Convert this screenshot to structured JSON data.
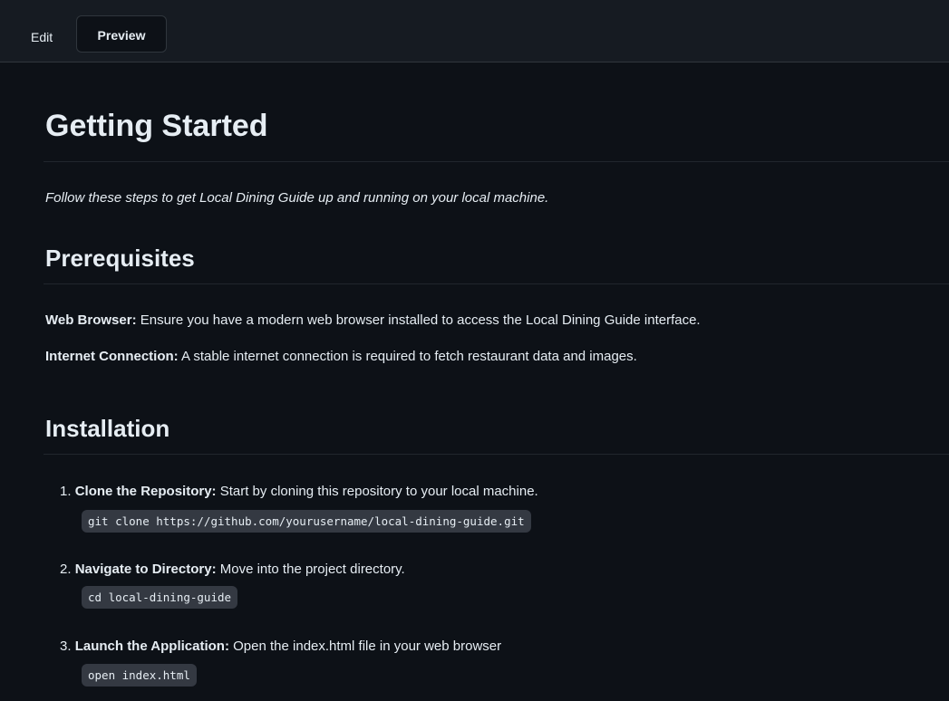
{
  "tabs": {
    "edit_label": "Edit",
    "preview_label": "Preview"
  },
  "doc": {
    "title": "Getting Started",
    "intro": "Follow these steps to get Local Dining Guide up and running on your local machine.",
    "prerequisites": {
      "heading": "Prerequisites",
      "items": [
        {
          "label": "Web Browser:",
          "text": " Ensure you have a modern web browser installed to access the Local Dining Guide interface."
        },
        {
          "label": "Internet Connection:",
          "text": " A stable internet connection is required to fetch restaurant data and images."
        }
      ]
    },
    "installation": {
      "heading": "Installation",
      "steps": [
        {
          "num": "1.",
          "label": "Clone the Repository:",
          "text": " Start by cloning this repository to your local machine.",
          "code": "git clone https://github.com/yourusername/local-dining-guide.git"
        },
        {
          "num": "2.",
          "label": "Navigate to Directory:",
          "text": " Move into the project directory.",
          "code": "cd local-dining-guide"
        },
        {
          "num": "3.",
          "label": "Launch the Application:",
          "text": " Open the index.html file in your web browser",
          "code": "open index.html"
        }
      ]
    }
  }
}
